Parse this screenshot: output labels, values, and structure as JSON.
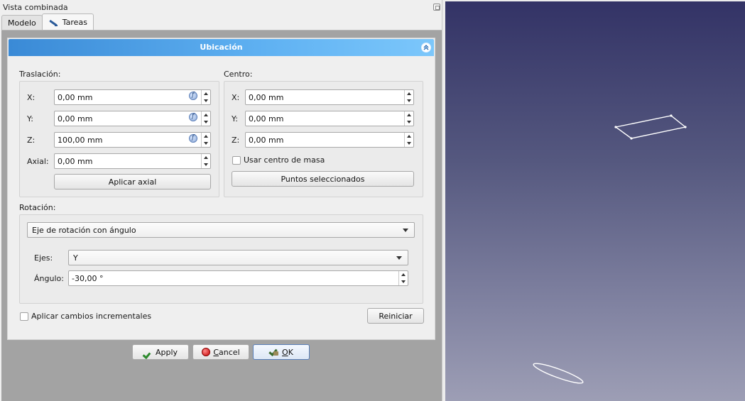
{
  "window": {
    "title": "Vista combinada"
  },
  "tabs": [
    {
      "label": "Modelo",
      "active": false
    },
    {
      "label": "Tareas",
      "active": true,
      "icon": "pencil-icon"
    }
  ],
  "panel": {
    "title": "Ubicación",
    "collapse_icon": "chevron-up-double-icon"
  },
  "traslacion": {
    "label": "Traslación:",
    "x_label": "X:",
    "x_value": "0,00 mm",
    "y_label": "Y:",
    "y_value": "0,00 mm",
    "z_label": "Z:",
    "z_value": "100,00 mm",
    "axial_label": "Axial:",
    "axial_value": "0,00 mm",
    "apply_axial_label": "Aplicar axial"
  },
  "centro": {
    "label": "Centro:",
    "x_label": "X:",
    "x_value": "0,00 mm",
    "y_label": "Y:",
    "y_value": "0,00 mm",
    "z_label": "Z:",
    "z_value": "0,00 mm",
    "center_of_mass_label": "Usar centro de masa",
    "center_of_mass_checked": false,
    "selected_points_label": "Puntos seleccionados"
  },
  "rotacion": {
    "label": "Rotación:",
    "mode_value": "Eje de rotación con ángulo",
    "axes_label": "Ejes:",
    "axes_value": "Y",
    "angle_label": "Ángulo:",
    "angle_value": "-30,00 °"
  },
  "incremental": {
    "label": "Aplicar cambios incrementales",
    "checked": false
  },
  "reset_label": "Reiniciar",
  "dialog_buttons": {
    "apply": "Apply",
    "cancel": "Cancel",
    "ok": "OK"
  },
  "colors": {
    "header_accent": "#3a8ad6",
    "viewport_top": "#333366",
    "viewport_bottom": "#9d9eb5"
  }
}
